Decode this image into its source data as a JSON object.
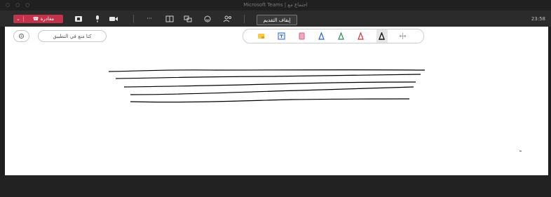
{
  "window": {
    "title": "Microsoft Teams | اجتماع مع",
    "controls": [
      "○",
      "○",
      "○"
    ]
  },
  "toolbar": {
    "leave_label": "مغادرة",
    "leave_chevron": "⌄",
    "stop_presenting_label": "إيقاف التقديم",
    "time": "23:58",
    "more_label": "···"
  },
  "whiteboard": {
    "settings_icon": "gear-icon",
    "close_label": "كتا منع في التطبيق",
    "tools": [
      "move",
      "marker-black",
      "marker-red",
      "marker-green",
      "marker-blue",
      "eraser-pink",
      "text-box",
      "sticky-note"
    ],
    "colors": {
      "pen_black": "#111111",
      "pen_red": "#d13438",
      "pen_green": "#2e8b57",
      "pen_blue": "#2a64c8",
      "eraser": "#f2a7c3",
      "sticky": "#f7c948",
      "stroke": "#000000"
    }
  },
  "colors": {
    "leave_red": "#c4314b",
    "toolbar_bg": "#2b2b2b",
    "board_bg": "#ffffff"
  }
}
